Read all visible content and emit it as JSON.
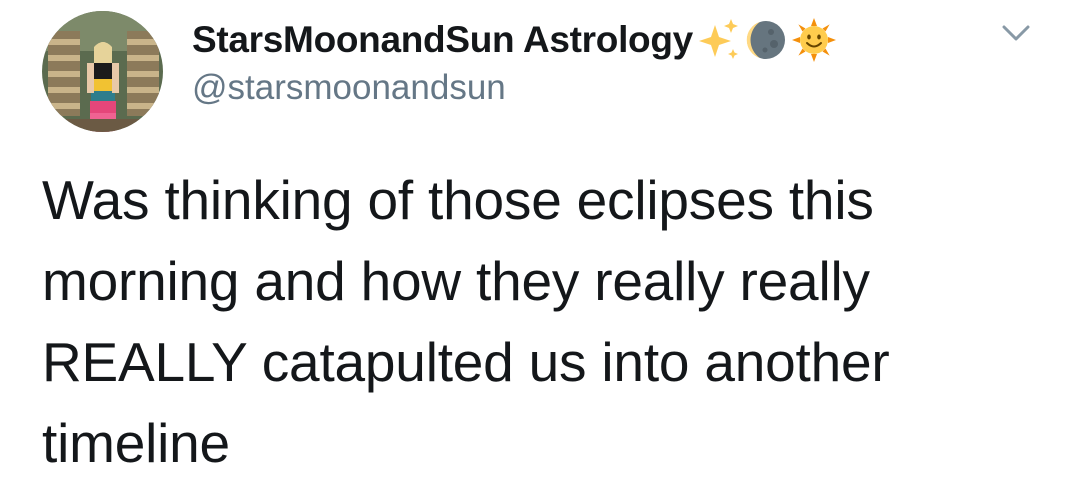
{
  "tweet": {
    "author": {
      "display_name": "StarsMoonandSun Astrology",
      "name_emojis": [
        "sparkles-icon",
        "waning-crescent-moon-icon",
        "sun-with-face-icon"
      ],
      "handle": "@starsmoonandsun",
      "avatar": "profile-photo"
    },
    "menu_icon": "chevron-down-icon",
    "text_lines": [
      "Was thinking of those eclipses this",
      "morning and how they really really",
      "REALLY catapulted us into another",
      "timeline"
    ]
  },
  "colors": {
    "name": "#14171a",
    "handle": "#657786",
    "text": "#14171a",
    "caret": "#8899a6",
    "background": "#ffffff"
  }
}
